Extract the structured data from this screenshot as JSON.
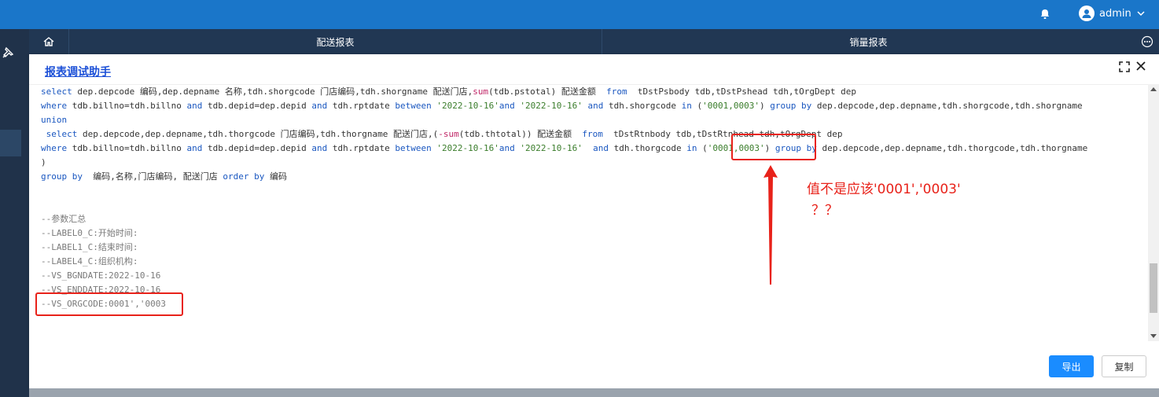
{
  "topbar": {
    "username": "admin"
  },
  "tabs": [
    "配送报表",
    "销量报表"
  ],
  "dialog": {
    "title": "报表调试助手",
    "buttons": {
      "export": "导出",
      "copy": "复制"
    }
  },
  "code": {
    "lines": [
      [
        {
          "t": "select ",
          "c": "kw"
        },
        {
          "t": "dep.depcode 编码,dep.depname 名称,tdh.shorgcode 门店编码,tdh.shorgname 配送门店,"
        },
        {
          "t": "sum",
          "c": "fn"
        },
        {
          "t": "(tdb.pstotal) 配送金额  "
        },
        {
          "t": "from",
          "c": "kw"
        },
        {
          "t": "  tDstPsbody tdb,tDstPshead tdh,tOrgDept dep"
        }
      ],
      [
        {
          "t": "where ",
          "c": "kw"
        },
        {
          "t": "tdb.billno=tdh.billno "
        },
        {
          "t": "and",
          "c": "kw"
        },
        {
          "t": " tdb.depid=dep.depid "
        },
        {
          "t": "and",
          "c": "kw"
        },
        {
          "t": " tdh.rptdate "
        },
        {
          "t": "between",
          "c": "kw"
        },
        {
          "t": " "
        },
        {
          "t": "'2022-10-16'",
          "c": "str"
        },
        {
          "t": "and",
          "c": "kw"
        },
        {
          "t": " "
        },
        {
          "t": "'2022-10-16'",
          "c": "str"
        },
        {
          "t": " "
        },
        {
          "t": "and",
          "c": "kw"
        },
        {
          "t": " tdh.shorgcode "
        },
        {
          "t": "in",
          "c": "kw"
        },
        {
          "t": " ("
        },
        {
          "t": "'0001,0003'",
          "c": "str"
        },
        {
          "t": ") "
        },
        {
          "t": "group by",
          "c": "kw"
        },
        {
          "t": " dep.depcode,dep.depname,tdh.shorgcode,tdh.shorgname"
        }
      ],
      [
        {
          "t": "union",
          "c": "kw"
        }
      ],
      [
        {
          "t": " "
        },
        {
          "t": "select",
          "c": "kw"
        },
        {
          "t": " dep.depcode,dep.depname,tdh.thorgcode 门店编码,tdh.thorgname 配送门店,("
        },
        {
          "t": "-sum",
          "c": "fn"
        },
        {
          "t": "(tdb.thtotal)) 配送金额  "
        },
        {
          "t": "from",
          "c": "kw"
        },
        {
          "t": "  tDstRtnbody tdb,tDstRtnhead tdh,tOrgDept dep"
        }
      ],
      [
        {
          "t": "where ",
          "c": "kw"
        },
        {
          "t": "tdb.billno=tdh.billno "
        },
        {
          "t": "and",
          "c": "kw"
        },
        {
          "t": " tdb.depid=dep.depid "
        },
        {
          "t": "and",
          "c": "kw"
        },
        {
          "t": " tdh.rptdate "
        },
        {
          "t": "between",
          "c": "kw"
        },
        {
          "t": " "
        },
        {
          "t": "'2022-10-16'",
          "c": "str"
        },
        {
          "t": "and",
          "c": "kw"
        },
        {
          "t": " "
        },
        {
          "t": "'2022-10-16'",
          "c": "str"
        },
        {
          "t": "  "
        },
        {
          "t": "and",
          "c": "kw"
        },
        {
          "t": " tdh.thorgcode "
        },
        {
          "t": "in",
          "c": "kw"
        },
        {
          "t": " ("
        },
        {
          "t": "'0001,0003'",
          "c": "str"
        },
        {
          "t": ") "
        },
        {
          "t": "group by",
          "c": "kw"
        },
        {
          "t": " dep.depcode,dep.depname,tdh.thorgcode,tdh.thorgname"
        }
      ],
      [
        {
          "t": ")"
        }
      ],
      [
        {
          "t": "group by",
          "c": "kw"
        },
        {
          "t": "  编码,名称,门店编码, 配送门店 "
        },
        {
          "t": "order by",
          "c": "kw"
        },
        {
          "t": " 编码"
        }
      ],
      [],
      [],
      [
        {
          "t": "--参数汇总",
          "c": "cm"
        }
      ],
      [
        {
          "t": "--LABEL0_C:开始时间:",
          "c": "cm"
        }
      ],
      [
        {
          "t": "--LABEL1_C:结束时间:",
          "c": "cm"
        }
      ],
      [
        {
          "t": "--LABEL4_C:组织机构:",
          "c": "cm"
        }
      ],
      [
        {
          "t": "--VS_BGNDATE:2022-10-16",
          "c": "cm"
        }
      ],
      [
        {
          "t": "--VS_ENDDATE:2022-10-16",
          "c": "cm"
        }
      ],
      [
        {
          "t": "--VS_ORGCODE:0001','0003",
          "c": "cm"
        }
      ]
    ]
  },
  "annotation": {
    "line1": "值不是应该'0001','0003'",
    "line2": "？？",
    "color": "#e8221a"
  },
  "colors": {
    "topbar": "#1a76c9",
    "tabsbar": "#213753",
    "accent": "#1a8cff"
  },
  "icons": [
    "bell-icon",
    "user-avatar-icon",
    "chevron-down-icon",
    "pin-icon",
    "home-icon",
    "more-icon",
    "maximize-icon",
    "close-icon"
  ]
}
